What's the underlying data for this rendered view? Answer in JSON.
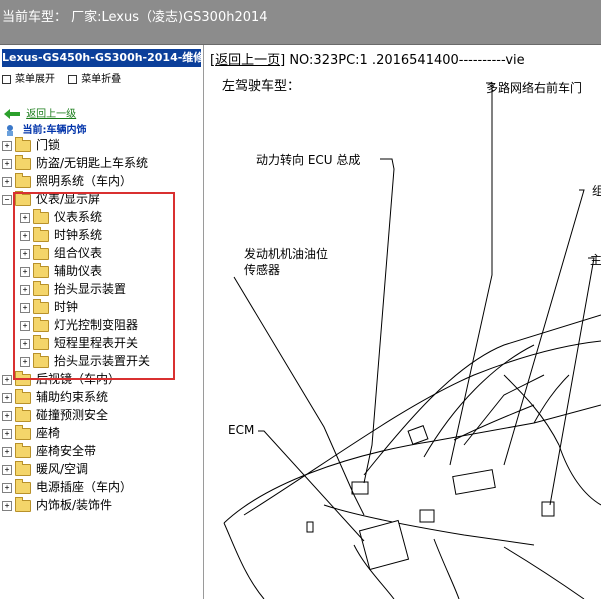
{
  "app": {
    "title": "当前车型： 厂家:Lexus（凌志)GS300h2014"
  },
  "left_pane": {
    "title": "Lexus-GS450h-GS300h-2014-维修",
    "expand_all": "菜单展开",
    "collapse_all": "菜单折叠",
    "back": "返回上一级",
    "current": "当前:车辆内饰"
  },
  "tree": {
    "items": [
      {
        "label": "门锁",
        "state": "+"
      },
      {
        "label": "防盗/无钥匙上车系统",
        "state": "+"
      },
      {
        "label": "照明系统（车内）",
        "state": "+"
      },
      {
        "label": "仪表/显示屏",
        "state": "−"
      },
      {
        "label": "仪表系统",
        "state": "+"
      },
      {
        "label": "时钟系统",
        "state": "+"
      },
      {
        "label": "组合仪表",
        "state": "+"
      },
      {
        "label": "辅助仪表",
        "state": "+"
      },
      {
        "label": "抬头显示装置",
        "state": "+"
      },
      {
        "label": "时钟",
        "state": "+"
      },
      {
        "label": "灯光控制变阻器",
        "state": "+"
      },
      {
        "label": "短程里程表开关",
        "state": "+"
      },
      {
        "label": "抬头显示装置开关",
        "state": "+"
      },
      {
        "label": "后视镜（车内）",
        "state": "+"
      },
      {
        "label": "辅助约束系统",
        "state": "+"
      },
      {
        "label": "碰撞预测安全",
        "state": "+"
      },
      {
        "label": "座椅",
        "state": "+"
      },
      {
        "label": "座椅安全带",
        "state": "+"
      },
      {
        "label": "暖风/空调",
        "state": "+"
      },
      {
        "label": "电源插座（车内）",
        "state": "+"
      },
      {
        "label": "内饰板/装饰件",
        "state": "+"
      }
    ]
  },
  "document": {
    "back_link": "返回上一页",
    "doc_no": "NO:323PC:1 .2016541400----------vie",
    "subtitle": "左驾驶车型：",
    "labels": {
      "ecu": "动力转向 ECU 总成",
      "oil_sensor_1": "发动机机油油位",
      "oil_sensor_2": "传感器",
      "ecm": "ECM",
      "multiplex": "多路网络右前车门",
      "cut_1": "组",
      "cut_2": "主"
    }
  }
}
